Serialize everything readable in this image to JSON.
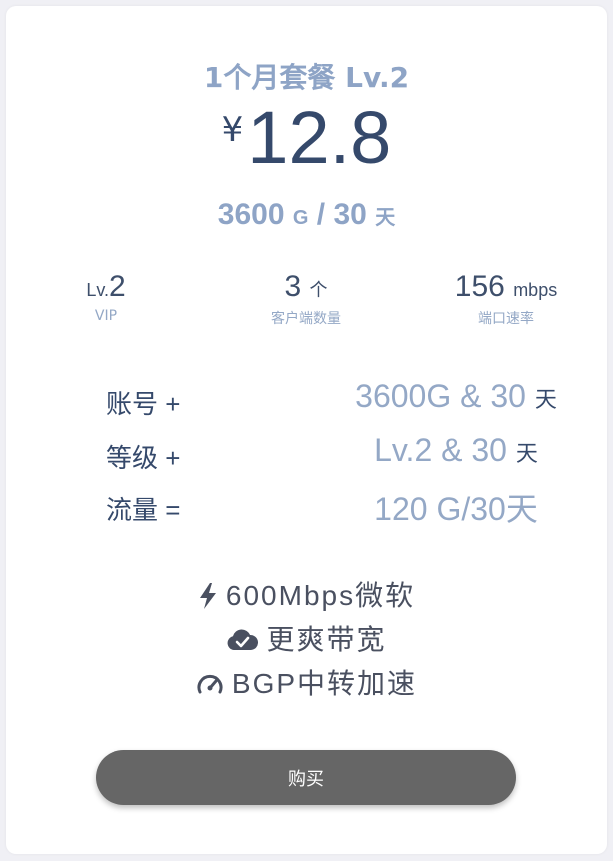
{
  "plan": {
    "title": "1个月套餐 Lv.2",
    "currency": "¥",
    "price": "12.8",
    "quota_value": "3600",
    "quota_unit": "G",
    "quota_sep": "/",
    "quota_days": "30",
    "quota_day_unit": "天"
  },
  "stats": [
    {
      "prefix": "Lv.",
      "value": "2",
      "unit": "",
      "label": "VIP"
    },
    {
      "prefix": "",
      "value": "3",
      "unit": "个",
      "label": "客户端数量"
    },
    {
      "prefix": "",
      "value": "156",
      "unit": "mbps",
      "label": "端口速率"
    }
  ],
  "calc": [
    {
      "left": "账号 +",
      "right": "3600G & 30",
      "unit": "天"
    },
    {
      "left": "等级 +",
      "right": "Lv.2 & 30",
      "unit": "天"
    },
    {
      "left": "流量 =",
      "right": "120 G/30天",
      "unit": ""
    }
  ],
  "features": [
    {
      "icon": "lightning-icon",
      "text": "600Mbps微软"
    },
    {
      "icon": "cloud-check-icon",
      "text": "更爽带宽"
    },
    {
      "icon": "speedometer-icon",
      "text": "BGP中转加速"
    }
  ],
  "buy_label": "购买",
  "colors": {
    "title": "#8ea4c6",
    "price": "#35496b",
    "button": "#666666",
    "background": "#f0f0f5"
  }
}
